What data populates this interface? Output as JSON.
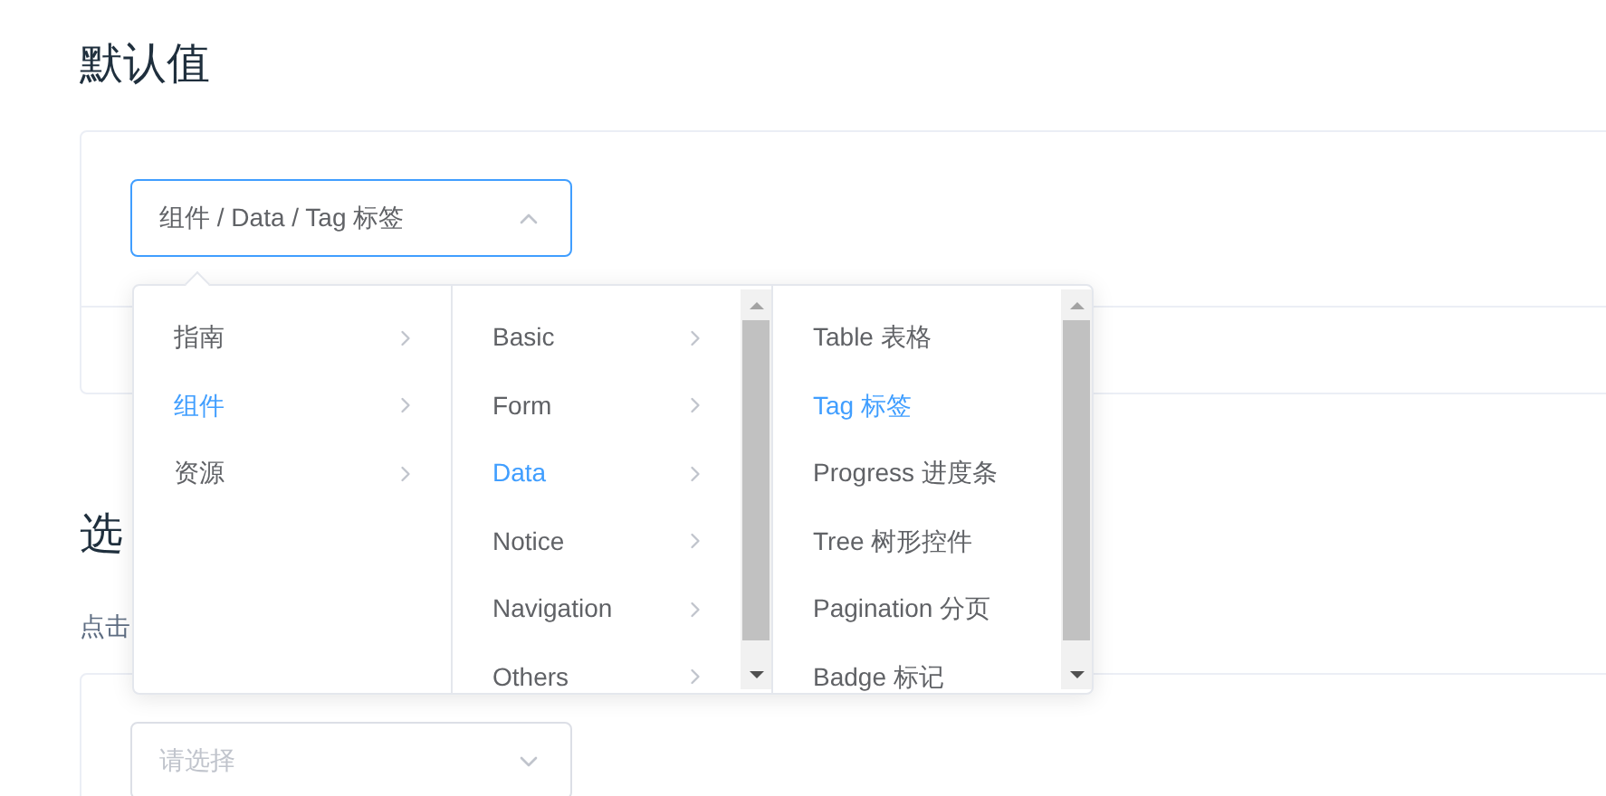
{
  "sections": [
    {
      "title": "默认值",
      "cascader": {
        "value": "组件 / Data / Tag 标签",
        "open": true
      }
    },
    {
      "title": "选",
      "description": "点击",
      "cascader": {
        "placeholder": "请选择",
        "open": false
      }
    }
  ],
  "dropdown": {
    "columns": [
      {
        "scrollbar": false,
        "items": [
          {
            "label": "指南",
            "selected": false,
            "expandable": true
          },
          {
            "label": "组件",
            "selected": true,
            "expandable": true
          },
          {
            "label": "资源",
            "selected": false,
            "expandable": true
          }
        ]
      },
      {
        "scrollbar": true,
        "items": [
          {
            "label": "Basic",
            "selected": false,
            "expandable": true
          },
          {
            "label": "Form",
            "selected": false,
            "expandable": true
          },
          {
            "label": "Data",
            "selected": true,
            "expandable": true
          },
          {
            "label": "Notice",
            "selected": false,
            "expandable": true
          },
          {
            "label": "Navigation",
            "selected": false,
            "expandable": true
          },
          {
            "label": "Others",
            "selected": false,
            "expandable": true
          }
        ]
      },
      {
        "scrollbar": true,
        "items": [
          {
            "label": "Table 表格",
            "selected": false,
            "expandable": false
          },
          {
            "label": "Tag 标签",
            "selected": true,
            "expandable": false
          },
          {
            "label": "Progress 进度条",
            "selected": false,
            "expandable": false
          },
          {
            "label": "Tree 树形控件",
            "selected": false,
            "expandable": false
          },
          {
            "label": "Pagination 分页",
            "selected": false,
            "expandable": false
          },
          {
            "label": "Badge 标记",
            "selected": false,
            "expandable": false
          }
        ]
      }
    ]
  }
}
